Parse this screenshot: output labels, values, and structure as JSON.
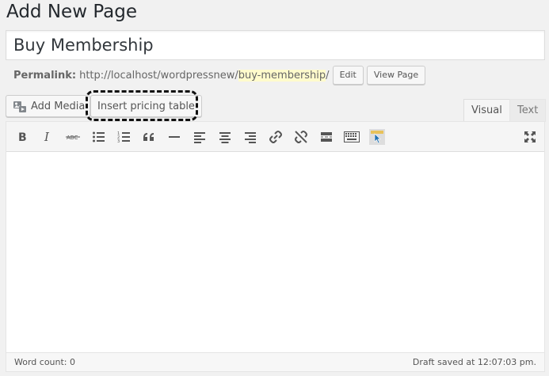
{
  "page_title": "Add New Page",
  "title_field": {
    "value": "Buy Membership"
  },
  "permalink": {
    "label": "Permalink:",
    "base": "http://localhost/wordpressnew/",
    "slug": "buy-membership",
    "trail": "/",
    "edit_label": "Edit",
    "view_label": "View Page"
  },
  "media_buttons": {
    "add_media_label": "Add Media",
    "pricing_label": "Insert pricing table"
  },
  "tabs": {
    "visual": "Visual",
    "text": "Text"
  },
  "toolbar_icons": [
    "bold-icon",
    "italic-icon",
    "strikethrough-icon",
    "bulleted-list-icon",
    "numbered-list-icon",
    "blockquote-icon",
    "horizontal-line-icon",
    "align-left-icon",
    "align-center-icon",
    "align-right-icon",
    "insert-link-icon",
    "remove-link-icon",
    "read-more-icon",
    "toolbar-toggle-icon",
    "pricing-table-icon",
    "fullscreen-icon"
  ],
  "status_bar": {
    "word_count": "Word count: 0",
    "draft_saved": "Draft saved at 12:07:03 pm."
  },
  "colors": {
    "accent_dash": "#111111",
    "slug_highlight": "#fffbcc",
    "pricing_icon": "#e8c25a"
  }
}
